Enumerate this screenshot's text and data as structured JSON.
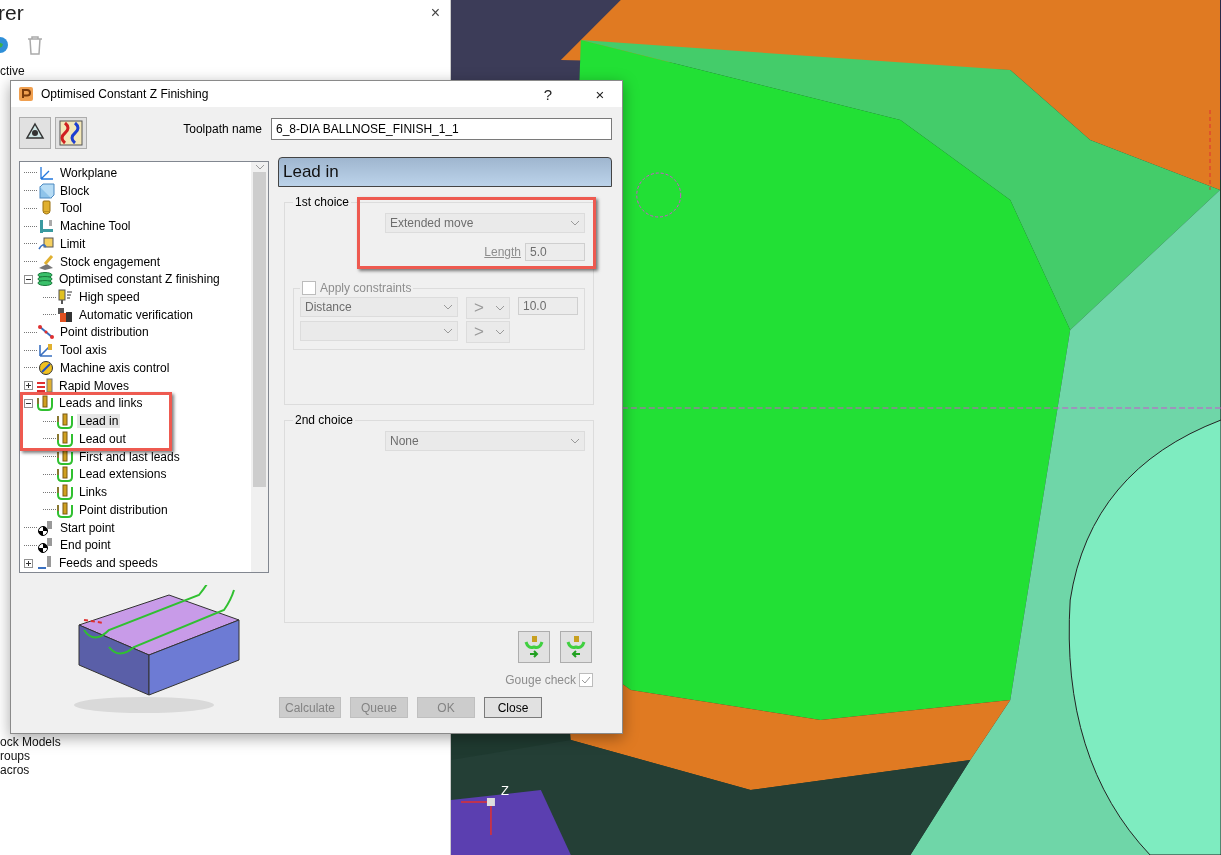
{
  "explorer": {
    "title": "rer",
    "close": "×",
    "items_above": [
      "ctive"
    ],
    "items_below": [
      "ock Models",
      "roups",
      "acros"
    ]
  },
  "viewport": {
    "axis_label": "Z"
  },
  "dialog": {
    "title": "Optimised Constant Z Finishing",
    "help": "?",
    "close": "×",
    "toolpath_name": {
      "label": "Toolpath name",
      "value": "6_8-DIA BALLNOSE_FINISH_1_1"
    },
    "tree": [
      {
        "label": "Workplane",
        "kind": "workplane",
        "selected": false
      },
      {
        "label": "Block",
        "kind": "block",
        "selected": false
      },
      {
        "label": "Tool",
        "kind": "tool",
        "selected": false
      },
      {
        "label": "Machine Tool",
        "kind": "machine",
        "selected": false
      },
      {
        "label": "Limit",
        "kind": "limit",
        "selected": false
      },
      {
        "label": "Stock engagement",
        "kind": "stock",
        "selected": false
      },
      {
        "label": "Optimised constant Z finishing",
        "kind": "strategy",
        "selected": false,
        "expanded": true,
        "children": [
          {
            "label": "High speed",
            "kind": "speed",
            "selected": false
          },
          {
            "label": "Automatic verification",
            "kind": "verify",
            "selected": false
          }
        ]
      },
      {
        "label": "Point distribution",
        "kind": "points",
        "selected": false
      },
      {
        "label": "Tool axis",
        "kind": "axis",
        "selected": false
      },
      {
        "label": "Machine axis control",
        "kind": "compass",
        "selected": false
      },
      {
        "label": "Rapid Moves",
        "kind": "rapid",
        "selected": false,
        "expanded": false
      },
      {
        "label": "Leads and links",
        "kind": "lead",
        "selected": false,
        "expanded": true,
        "children": [
          {
            "label": "Lead in",
            "kind": "lead",
            "selected": true
          },
          {
            "label": "Lead out",
            "kind": "lead",
            "selected": false
          },
          {
            "label": "First and last leads",
            "kind": "lead",
            "selected": false
          },
          {
            "label": "Lead extensions",
            "kind": "lead",
            "selected": false
          },
          {
            "label": "Links",
            "kind": "lead",
            "selected": false
          },
          {
            "label": "Point distribution",
            "kind": "lead",
            "selected": false
          }
        ]
      },
      {
        "label": "Start point",
        "kind": "point",
        "selected": false
      },
      {
        "label": "End point",
        "kind": "point",
        "selected": false
      },
      {
        "label": "Feeds and speeds",
        "kind": "feeds",
        "selected": false,
        "expanded": false
      }
    ],
    "section_title": "Lead in",
    "first_choice": {
      "title": "1st choice",
      "move": "Extended move",
      "length_label": "Length",
      "length": "5.0",
      "disabled": true,
      "constraints": {
        "label": "Apply constraints",
        "checked": false,
        "disabled": true,
        "measure": "Distance",
        "comparator_1": ">",
        "value": "10.0",
        "comparator_2": ">"
      }
    },
    "second_choice": {
      "title": "2nd choice",
      "move": "None"
    },
    "gouge_check": {
      "label": "Gouge check",
      "checked": true,
      "disabled": true
    },
    "buttons": [
      {
        "label": "Calculate",
        "disabled": true
      },
      {
        "label": "Queue",
        "disabled": true
      },
      {
        "label": "OK",
        "disabled": true
      },
      {
        "label": "Close",
        "disabled": false
      }
    ]
  }
}
